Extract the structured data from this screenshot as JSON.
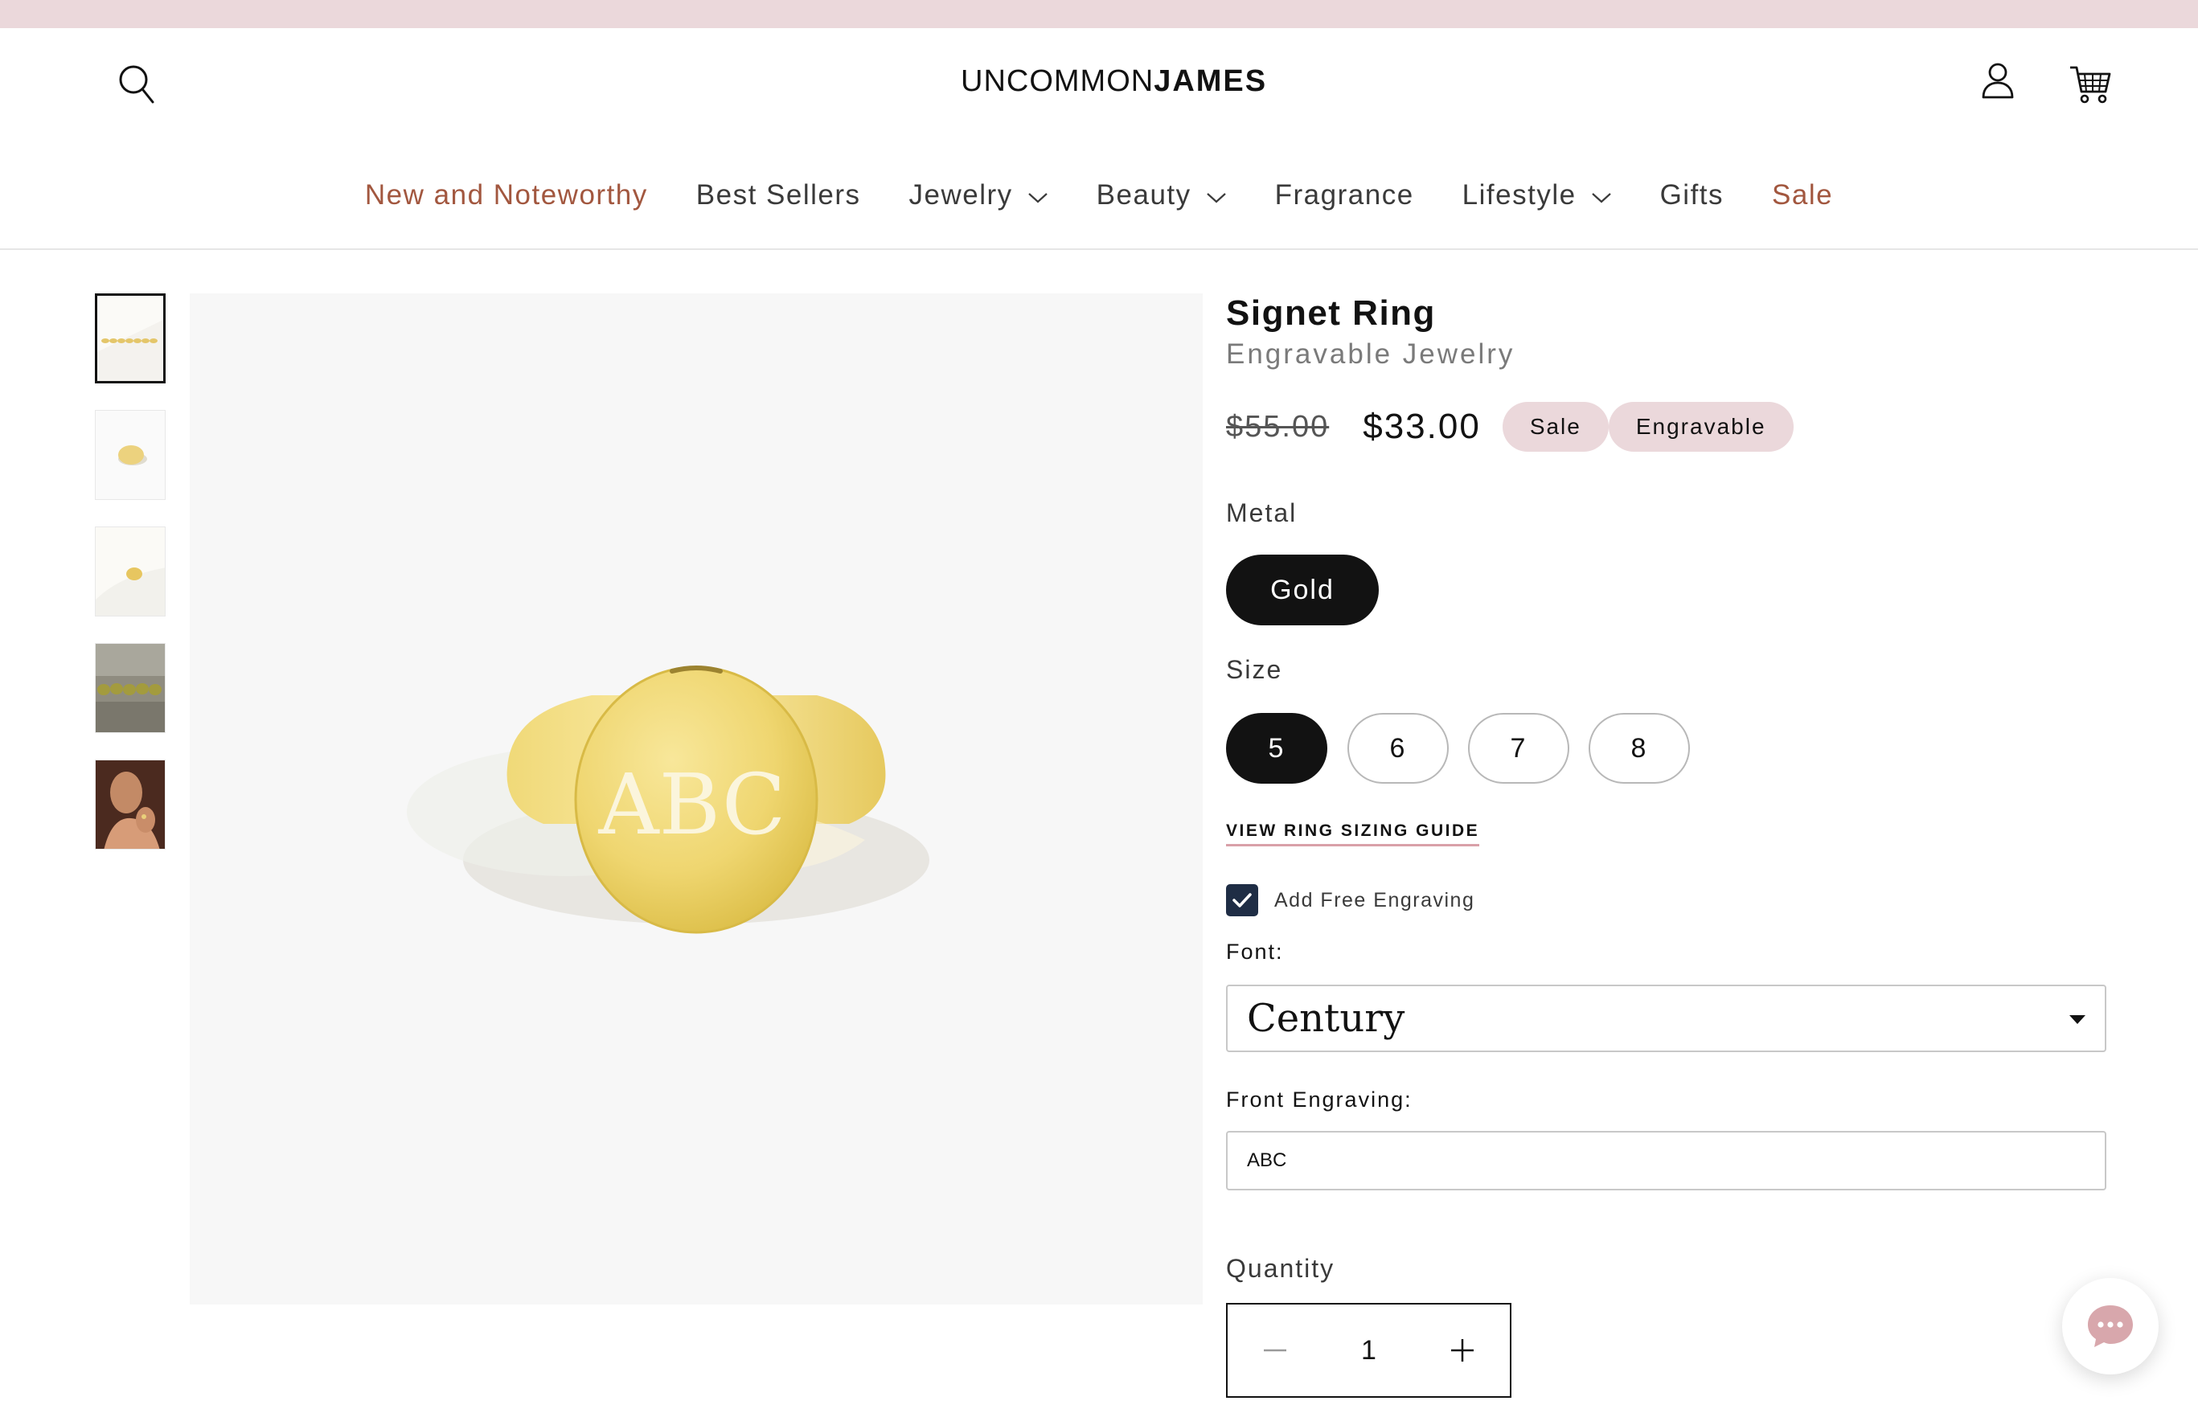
{
  "brand": {
    "logo_thin": "UNCOMMON",
    "logo_bold": "JAMES"
  },
  "nav": {
    "items": [
      {
        "label": "New and Noteworthy",
        "accent": true,
        "dropdown": false
      },
      {
        "label": "Best Sellers",
        "accent": false,
        "dropdown": false
      },
      {
        "label": "Jewelry",
        "accent": false,
        "dropdown": true
      },
      {
        "label": "Beauty",
        "accent": false,
        "dropdown": true
      },
      {
        "label": "Fragrance",
        "accent": false,
        "dropdown": false
      },
      {
        "label": "Lifestyle",
        "accent": false,
        "dropdown": true
      },
      {
        "label": "Gifts",
        "accent": false,
        "dropdown": false
      },
      {
        "label": "Sale",
        "accent": true,
        "dropdown": false
      }
    ]
  },
  "gallery": {
    "active_index": 0,
    "thumbnail_count": 5,
    "main_image_engraving": "ABC"
  },
  "product": {
    "title": "Signet Ring",
    "subtitle": "Engravable Jewelry",
    "price_original": "$55.00",
    "price_sale": "$33.00",
    "badges": [
      "Sale",
      "Engravable"
    ]
  },
  "options": {
    "metal_label": "Metal",
    "metal_values": [
      "Gold"
    ],
    "metal_selected": "Gold",
    "size_label": "Size",
    "size_values": [
      "5",
      "6",
      "7",
      "8"
    ],
    "size_selected": "5",
    "sizing_guide_link": "VIEW RING SIZING GUIDE"
  },
  "engraving": {
    "checkbox_label": "Add Free Engraving",
    "checked": true,
    "font_label": "Font:",
    "font_selected": "Century",
    "front_label": "Front Engraving:",
    "front_value": "ABC"
  },
  "quantity": {
    "label": "Quantity",
    "value": "1"
  },
  "colors": {
    "announcement_bar": "#ebd8db",
    "accent_text": "#a2573f",
    "badge_bg": "#ebd8db",
    "selected_pill": "#121212",
    "checkbox": "#1f2d45",
    "link_underline": "#d9a0a8"
  },
  "icons": [
    "search-icon",
    "account-icon",
    "cart-icon",
    "chevron-down-icon",
    "check-icon",
    "minus-icon",
    "plus-icon",
    "chat-icon"
  ]
}
